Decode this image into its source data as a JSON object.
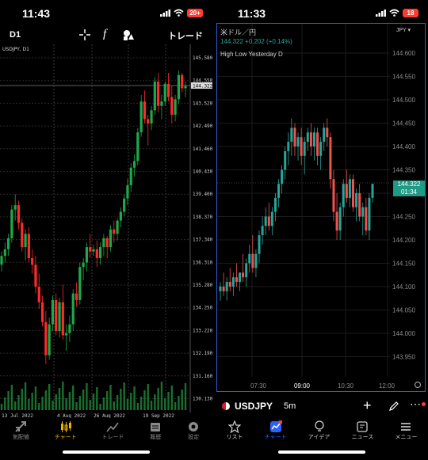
{
  "left_phone": {
    "status": {
      "time": "11:43",
      "battery": "20+"
    },
    "toolbar": {
      "timeframe": "D1",
      "crosshair_icon": "crosshair-icon",
      "indicator_label": "f",
      "objects_icon": "shapes-icon",
      "trade_label": "トレード"
    },
    "symbol_label": "USDJPY, D1",
    "price_ticks": [
      "145.580",
      "144.550",
      "143.520",
      "142.490",
      "141.460",
      "140.430",
      "139.400",
      "138.370",
      "137.340",
      "136.310",
      "135.280",
      "134.250",
      "133.220",
      "132.190",
      "131.160",
      "130.130"
    ],
    "current_price": "144.322",
    "date_ticks": [
      "13 Jul 2022",
      "4 Aug 2022",
      "26 Aug 2022",
      "19 Sep 2022"
    ],
    "tabs": [
      {
        "label": "気配値",
        "icon": "quotes-icon",
        "active": false
      },
      {
        "label": "チャート",
        "icon": "chart-icon",
        "active": true
      },
      {
        "label": "トレード",
        "icon": "trade-icon",
        "active": false
      },
      {
        "label": "履歴",
        "icon": "history-icon",
        "active": false
      },
      {
        "label": "設定",
        "icon": "settings-icon",
        "active": false
      }
    ],
    "colors": {
      "bull": "#1fa84a",
      "bear": "#ff2a2a",
      "active_tab": "#e8b400"
    }
  },
  "right_phone": {
    "status": {
      "time": "11:33",
      "battery": "18"
    },
    "pair_name": "米ドル／円",
    "currency_select": "JPY",
    "price_change": "144.322 +0.202 (+0.14%)",
    "indicator": "High Low Yesterday D",
    "price_ticks": [
      "144.600",
      "144.550",
      "144.500",
      "144.450",
      "144.400",
      "144.350",
      "144.300",
      "144.250",
      "144.200",
      "144.150",
      "144.100",
      "144.050",
      "144.000",
      "143.950"
    ],
    "current_price": "144.322",
    "countdown": "01:34",
    "time_ticks": [
      "07:30",
      "09:00",
      "10:30",
      "12:00"
    ],
    "symbol": "USDJPY",
    "interval": "5m",
    "tabs": [
      {
        "label": "リスト",
        "icon": "star-icon",
        "active": false
      },
      {
        "label": "チャート",
        "icon": "chart-icon",
        "active": true
      },
      {
        "label": "アイデア",
        "icon": "bulb-icon",
        "active": false
      },
      {
        "label": "ニュース",
        "icon": "news-icon",
        "active": false
      },
      {
        "label": "メニュー",
        "icon": "menu-icon",
        "active": false
      }
    ],
    "colors": {
      "bull": "#26a69a",
      "bear": "#ef5350",
      "active_tab": "#2962ff",
      "frame": "#2f5bd8"
    }
  }
}
